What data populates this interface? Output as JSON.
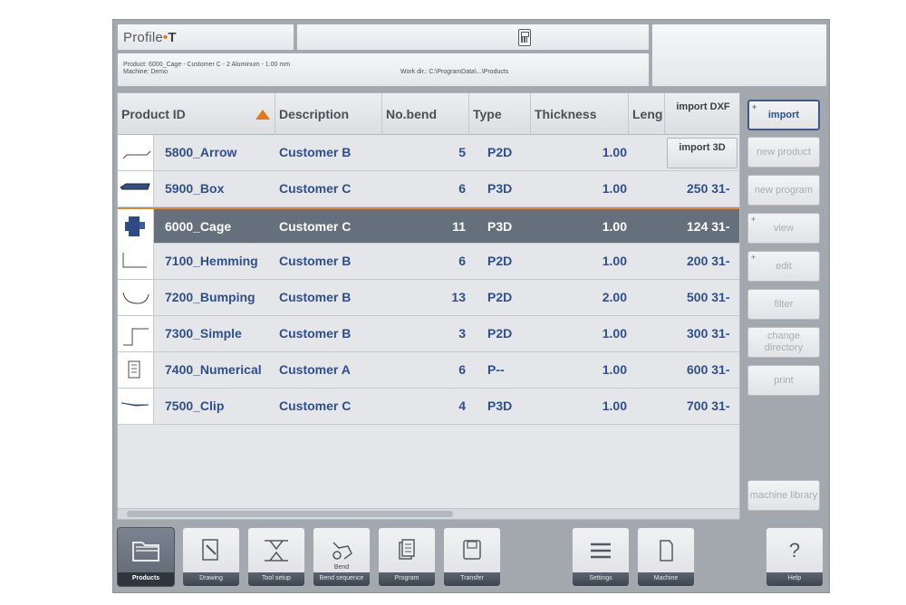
{
  "header": {
    "app_name_prefix": "Profile",
    "app_name_dot": "•",
    "app_name_suffix": "T",
    "product_line": "Product: 6000_Cage - Customer C - 2 Aluminum - 1.00 mm",
    "machine_line": "Machine: Demo",
    "workdir": "Work dir.: C:\\ProgramData\\...\\Products"
  },
  "table": {
    "columns": [
      "Product ID",
      "Description",
      "No.bend",
      "Type",
      "Thickness",
      "Leng",
      "import DXF"
    ],
    "rows": [
      {
        "id": "5800_Arrow",
        "description": "Customer B",
        "bends": "5",
        "type": "P2D",
        "thickness": "1.00",
        "length": "",
        "thumb": "arrow-profile-icon"
      },
      {
        "id": "5900_Box",
        "description": "Customer C",
        "bends": "6",
        "type": "P3D",
        "thickness": "1.00",
        "length": "250 31-",
        "thumb": "box-profile-icon"
      },
      {
        "id": "6000_Cage",
        "description": "Customer C",
        "bends": "11",
        "type": "P3D",
        "thickness": "1.00",
        "length": "124 31-",
        "thumb": "cage-profile-icon"
      },
      {
        "id": "7100_Hemming",
        "description": "Customer B",
        "bends": "6",
        "type": "P2D",
        "thickness": "1.00",
        "length": "200 31-",
        "thumb": "hemming-profile-icon"
      },
      {
        "id": "7200_Bumping",
        "description": "Customer B",
        "bends": "13",
        "type": "P2D",
        "thickness": "2.00",
        "length": "500 31-",
        "thumb": "bumping-profile-icon"
      },
      {
        "id": "7300_Simple",
        "description": "Customer B",
        "bends": "3",
        "type": "P2D",
        "thickness": "1.00",
        "length": "300 31-",
        "thumb": "simple-profile-icon"
      },
      {
        "id": "7400_Numerical",
        "description": "Customer A",
        "bends": "6",
        "type": "P--",
        "thickness": "1.00",
        "length": "600 31-",
        "thumb": "numerical-profile-icon"
      },
      {
        "id": "7500_Clip",
        "description": "Customer C",
        "bends": "4",
        "type": "P3D",
        "thickness": "1.00",
        "length": "700 31-",
        "thumb": "clip-profile-icon"
      }
    ],
    "import_3d_label": "import 3D"
  },
  "side_buttons": {
    "import": "import",
    "new_product": "new product",
    "new_program": "new program",
    "view": "view",
    "edit": "edit",
    "filter": "filter",
    "change_directory": "change directory",
    "print": "print",
    "machine_library": "machine library"
  },
  "nav": {
    "products": "Products",
    "drawing": "Drawing",
    "tool_setup": "Tool setup",
    "bend_sequence": "Bend sequence",
    "program": "Program",
    "transfer": "Transfer",
    "settings": "Settings",
    "machine": "Machine",
    "help": "Help",
    "help_glyph": "?",
    "bend_label": "Bend"
  },
  "colors": {
    "accent": "#e0781d",
    "selected_row": "#66707c",
    "link_text": "#2f4f8a"
  }
}
